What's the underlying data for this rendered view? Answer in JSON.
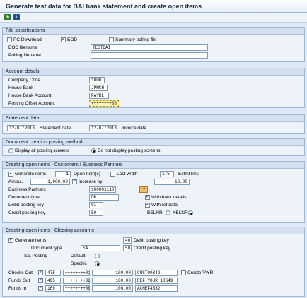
{
  "title": "Generate test data for BAI bank statement and create open items",
  "toolbar": {
    "icons": [
      "execute-icon",
      "info-icon"
    ]
  },
  "file_spec": {
    "header": "File specifications",
    "pc_download": "PC Download",
    "eod": "EOD",
    "summary_polling": "Summary polling file",
    "eod_filename_label": "EOD filename",
    "eod_filename_value": "TESTBAI",
    "polling_filename_label": "Polling filename",
    "polling_filename_value": ""
  },
  "account": {
    "header": "Account details",
    "company_code_label": "Company Code",
    "company_code": "1000",
    "house_bank_label": "House Bank",
    "house_bank": "JPMCH",
    "house_bank_account_label": "House Bank Account",
    "house_bank_account": "PAYRL",
    "posting_offset_label": "Posting Offset Account",
    "posting_offset": "++++++++08"
  },
  "statement": {
    "header": "Statement data",
    "date1": "12/07/2013",
    "statement_date_label": "Statement date",
    "date2": "12/07/2013",
    "invoice_date_label": "Invoice date"
  },
  "doc_method": {
    "header": "Document creation posting method",
    "opt1": "Display all posting screens",
    "opt2": "Do not display posting screens"
  },
  "customers": {
    "header": "Creating open items - Customers / Business Partners",
    "generate_items_label": "Generate items",
    "items_count": "1",
    "open_items_label": "Open Item(s)",
    "last_wdiff_label": "Last w/diff",
    "extml_value": "175",
    "extml_label": "ExtmlTms",
    "amount_label": "Amou..",
    "amount": "1,000.00",
    "increase_by_label": "Increase by",
    "increase_value": "10.00",
    "bp_label": "Business Partners",
    "bp_value": "1000011107",
    "doc_type_label": "Document type",
    "doc_type": "DR",
    "with_bank_details": "With bank details",
    "debit_key_label": "Debit posting key",
    "debit_key": "01",
    "with_ref_data": "With ref.data",
    "credit_key_label": "Credit posting key",
    "credit_key": "50",
    "belnr": "BELNR",
    "xblnr": "XBLNR"
  },
  "clearing": {
    "header": "Creating open items - Clearing accounts",
    "generate_items_label": "Generate items",
    "debit_key": "40",
    "debit_key_label": "Debit posting key",
    "doc_type_label": "Document type",
    "doc_type": "SA",
    "credit_key": "50",
    "credit_key_label": "Credit posting key",
    "sl_posting_label": "S/L Posting",
    "default_label": "Default",
    "specific_label": "Specific",
    "create_payr": "CreatePAYR",
    "rows": [
      {
        "label": "Checks Out",
        "gl": "475",
        "acct": "++++++++01",
        "amount": "100.00",
        "ref": "CUST00342"
      },
      {
        "label": "Funds Out",
        "gl": "495",
        "acct": "++++++++02",
        "amount": "100.00",
        "ref": "REF YOUR 10649"
      },
      {
        "label": "Funds In",
        "gl": "169",
        "acct": "++++++++08",
        "amount": "100.00",
        "ref": "ACHEF4682"
      }
    ]
  }
}
